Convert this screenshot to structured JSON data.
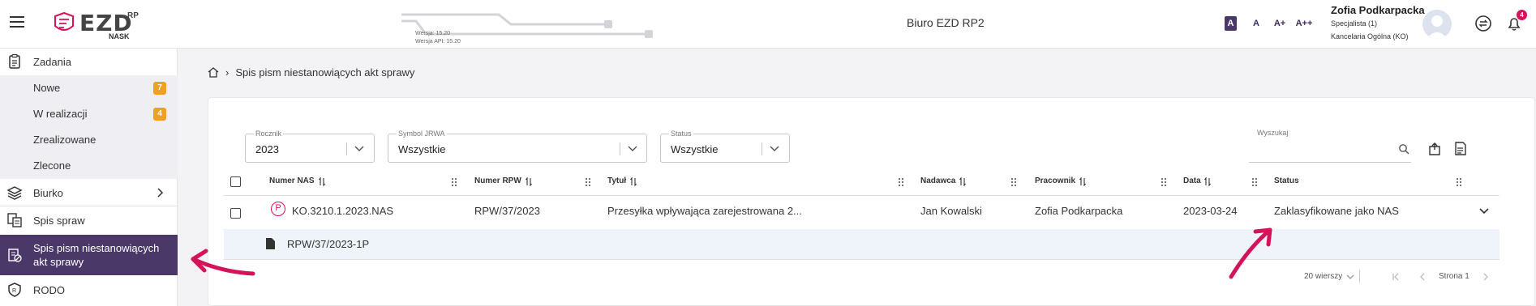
{
  "app": {
    "logo_name": "EZD",
    "logo_superscript": "RP",
    "logo_vendor": "NASK",
    "version": "Wersja: 15.20",
    "api_version": "Wersja API: 15.20",
    "title": "Biuro EZD RP2"
  },
  "font_sizes": [
    "A",
    "A",
    "A+",
    "A++"
  ],
  "user": {
    "name": "Zofia Podkarpacka",
    "role": "Specjalista (1)",
    "office": "Kancelaria Ogólna (KO)",
    "notifications": "4"
  },
  "sidebar": {
    "tasks": "Zadania",
    "sub": [
      {
        "label": "Nowe",
        "badge": "7"
      },
      {
        "label": "W realizacji",
        "badge": "4"
      },
      {
        "label": "Zrealizowane",
        "badge": ""
      },
      {
        "label": "Zlecone",
        "badge": ""
      }
    ],
    "desk": "Biurko",
    "cases": "Spis spraw",
    "active_line1": "Spis pism niestanowiących",
    "active_line2": "akt sprawy",
    "rodo": "RODO"
  },
  "breadcrumb": {
    "separator": "›",
    "current": "Spis pism niestanowiących akt sprawy"
  },
  "filters": {
    "year_label": "Rocznik",
    "year_value": "2023",
    "jrwa_label": "Symbol JRWA",
    "jrwa_value": "Wszystkie",
    "status_label": "Status",
    "status_value": "Wszystkie",
    "search_label": "Wyszukaj",
    "search_value": ""
  },
  "table": {
    "headers": [
      "Numer NAS",
      "Numer RPW",
      "Tytuł",
      "Nadawca",
      "Pracownik",
      "Data",
      "Status"
    ],
    "rows": [
      {
        "type_letter": "P",
        "nas": "KO.3210.1.2023.NAS",
        "rpw": "RPW/37/2023",
        "title": "Przesyłka wpływająca zarejestrowana 2...",
        "sender": "Jan Kowalski",
        "employee": "Zofia Podkarpacka",
        "date": "2023-03-24",
        "status": "Zaklasyfikowane jako NAS"
      }
    ],
    "subrow": "RPW/37/2023-1P"
  },
  "pager": {
    "rows_per_page": "20 wierszy",
    "page": "Strona 1"
  },
  "colors": {
    "accent": "#4a3968",
    "badge": "#f0a020",
    "notification": "#d4145a",
    "red_letter": "#d4145a"
  }
}
